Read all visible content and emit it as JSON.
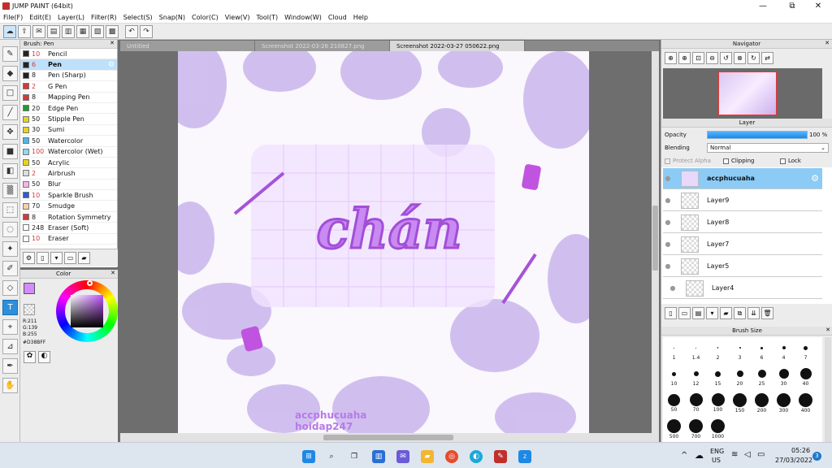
{
  "window": {
    "title": "JUMP PAINT (64bit)",
    "minimize": "—",
    "maximize": "⧉",
    "close": "✕"
  },
  "menu": [
    "File(F)",
    "Edit(E)",
    "Layer(L)",
    "Filter(R)",
    "Select(S)",
    "Snap(N)",
    "Color(C)",
    "View(V)",
    "Tool(T)",
    "Window(W)",
    "Cloud",
    "Help"
  ],
  "brush_panel": {
    "title": "Brush: Pen",
    "close": "✕",
    "items": [
      {
        "size": "10",
        "name": "Pencil",
        "color": "#222222",
        "size_color": "#d23b3b"
      },
      {
        "size": "6",
        "name": "Pen",
        "color": "#222222",
        "size_color": "#d23b3b"
      },
      {
        "size": "8",
        "name": "Pen (Sharp)",
        "color": "#222222",
        "size_color": "#222222"
      },
      {
        "size": "2",
        "name": "G Pen",
        "color": "#d23b3b",
        "size_color": "#d23b3b"
      },
      {
        "size": "8",
        "name": "Mapping Pen",
        "color": "#d23b3b",
        "size_color": "#222222"
      },
      {
        "size": "20",
        "name": "Edge Pen",
        "color": "#1e9e2a",
        "size_color": "#222222"
      },
      {
        "size": "50",
        "name": "Stipple Pen",
        "color": "#e6d51f",
        "size_color": "#222222"
      },
      {
        "size": "30",
        "name": "Sumi",
        "color": "#e6d51f",
        "size_color": "#222222"
      },
      {
        "size": "50",
        "name": "Watercolor",
        "color": "#4fb7e8",
        "size_color": "#222222"
      },
      {
        "size": "100",
        "name": "Watercolor (Wet)",
        "color": "#8fd6f2",
        "size_color": "#d23b3b"
      },
      {
        "size": "50",
        "name": "Acrylic",
        "color": "#e6d51f",
        "size_color": "#222222"
      },
      {
        "size": "2",
        "name": "Airbrush",
        "color": "#dddddd",
        "size_color": "#d23b3b"
      },
      {
        "size": "50",
        "name": "Blur",
        "color": "#f2b6e8",
        "size_color": "#222222"
      },
      {
        "size": "10",
        "name": "Sparkle Brush",
        "color": "#2f5bd6",
        "size_color": "#d23b3b"
      },
      {
        "size": "70",
        "name": "Smudge",
        "color": "#f2d0b0",
        "size_color": "#222222"
      },
      {
        "size": "8",
        "name": "Rotation Symmetry",
        "color": "#d23b3b",
        "size_color": "#222222"
      },
      {
        "size": "248",
        "name": "Eraser (Soft)",
        "color": "#ffffff",
        "size_color": "#222222"
      },
      {
        "size": "10",
        "name": "Eraser",
        "color": "#ffffff",
        "size_color": "#d23b3b"
      }
    ]
  },
  "color_panel": {
    "title": "Color",
    "r": "R:211",
    "g": "G:139",
    "b": "B:255",
    "hex": "#D38BFF",
    "current": "#d38bff"
  },
  "tabs": [
    {
      "label": "Untitled"
    },
    {
      "label": "Screenshot 2022-03-26 210827.png"
    },
    {
      "label": "Screenshot 2022-03-27 050622.png"
    }
  ],
  "canvas": {
    "headline": "chán",
    "watermark1": "accphucuaha",
    "watermark2": "hoidap247"
  },
  "navigator": {
    "title": "Navigator"
  },
  "layer_panel": {
    "title": "Layer",
    "opacity_label": "Opacity",
    "opacity_value": "100 %",
    "opacity": 1.0,
    "blending_label": "Blending",
    "blending_value": "Normal",
    "protect_alpha": "Protect Alpha",
    "clipping": "Clipping",
    "lock": "Lock",
    "layers": [
      "accphucuaha",
      "Layer9",
      "Layer8",
      "Layer7",
      "Layer5",
      "Layer4"
    ]
  },
  "brush_size": {
    "title": "Brush Size",
    "sizes": [
      "1",
      "1.4",
      "2",
      "3",
      "6",
      "4",
      "7",
      "10",
      "12",
      "15",
      "20",
      "25",
      "30",
      "40",
      "50",
      "70",
      "100",
      "150",
      "200",
      "300",
      "400",
      "500",
      "700",
      "1000"
    ]
  },
  "taskbar": {
    "lang1": "ENG",
    "lang2": "US",
    "time": "05:26",
    "date": "27/03/2022",
    "notif": "3"
  }
}
